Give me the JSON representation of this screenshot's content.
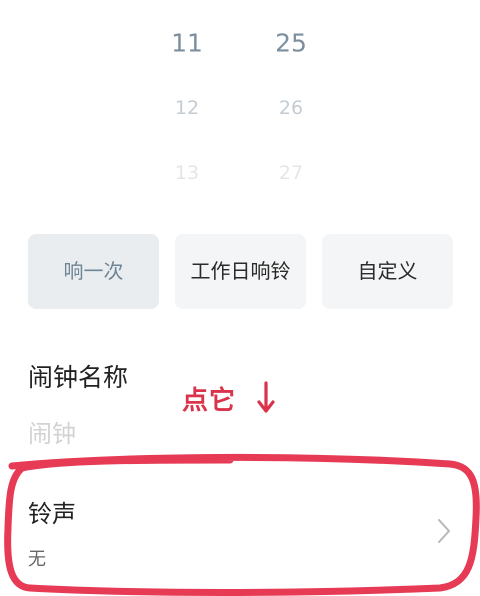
{
  "time_picker": {
    "hour": [
      "11",
      "12",
      "13"
    ],
    "minute": [
      "25",
      "26",
      "27"
    ]
  },
  "repeat": {
    "options": [
      "响一次",
      "工作日响铃",
      "自定义"
    ],
    "selected": "响一次"
  },
  "alarm_name": {
    "label": "闹钟名称",
    "placeholder": "闹钟"
  },
  "ringtone": {
    "label": "铃声",
    "value": "无"
  },
  "annotation": {
    "text": "点它",
    "color": "#d9344b",
    "arrow_icon": "down-arrow-icon"
  },
  "colors": {
    "accent": "#6f8596",
    "selected_bg": "#e9edf0",
    "button_bg": "#f4f5f6"
  }
}
